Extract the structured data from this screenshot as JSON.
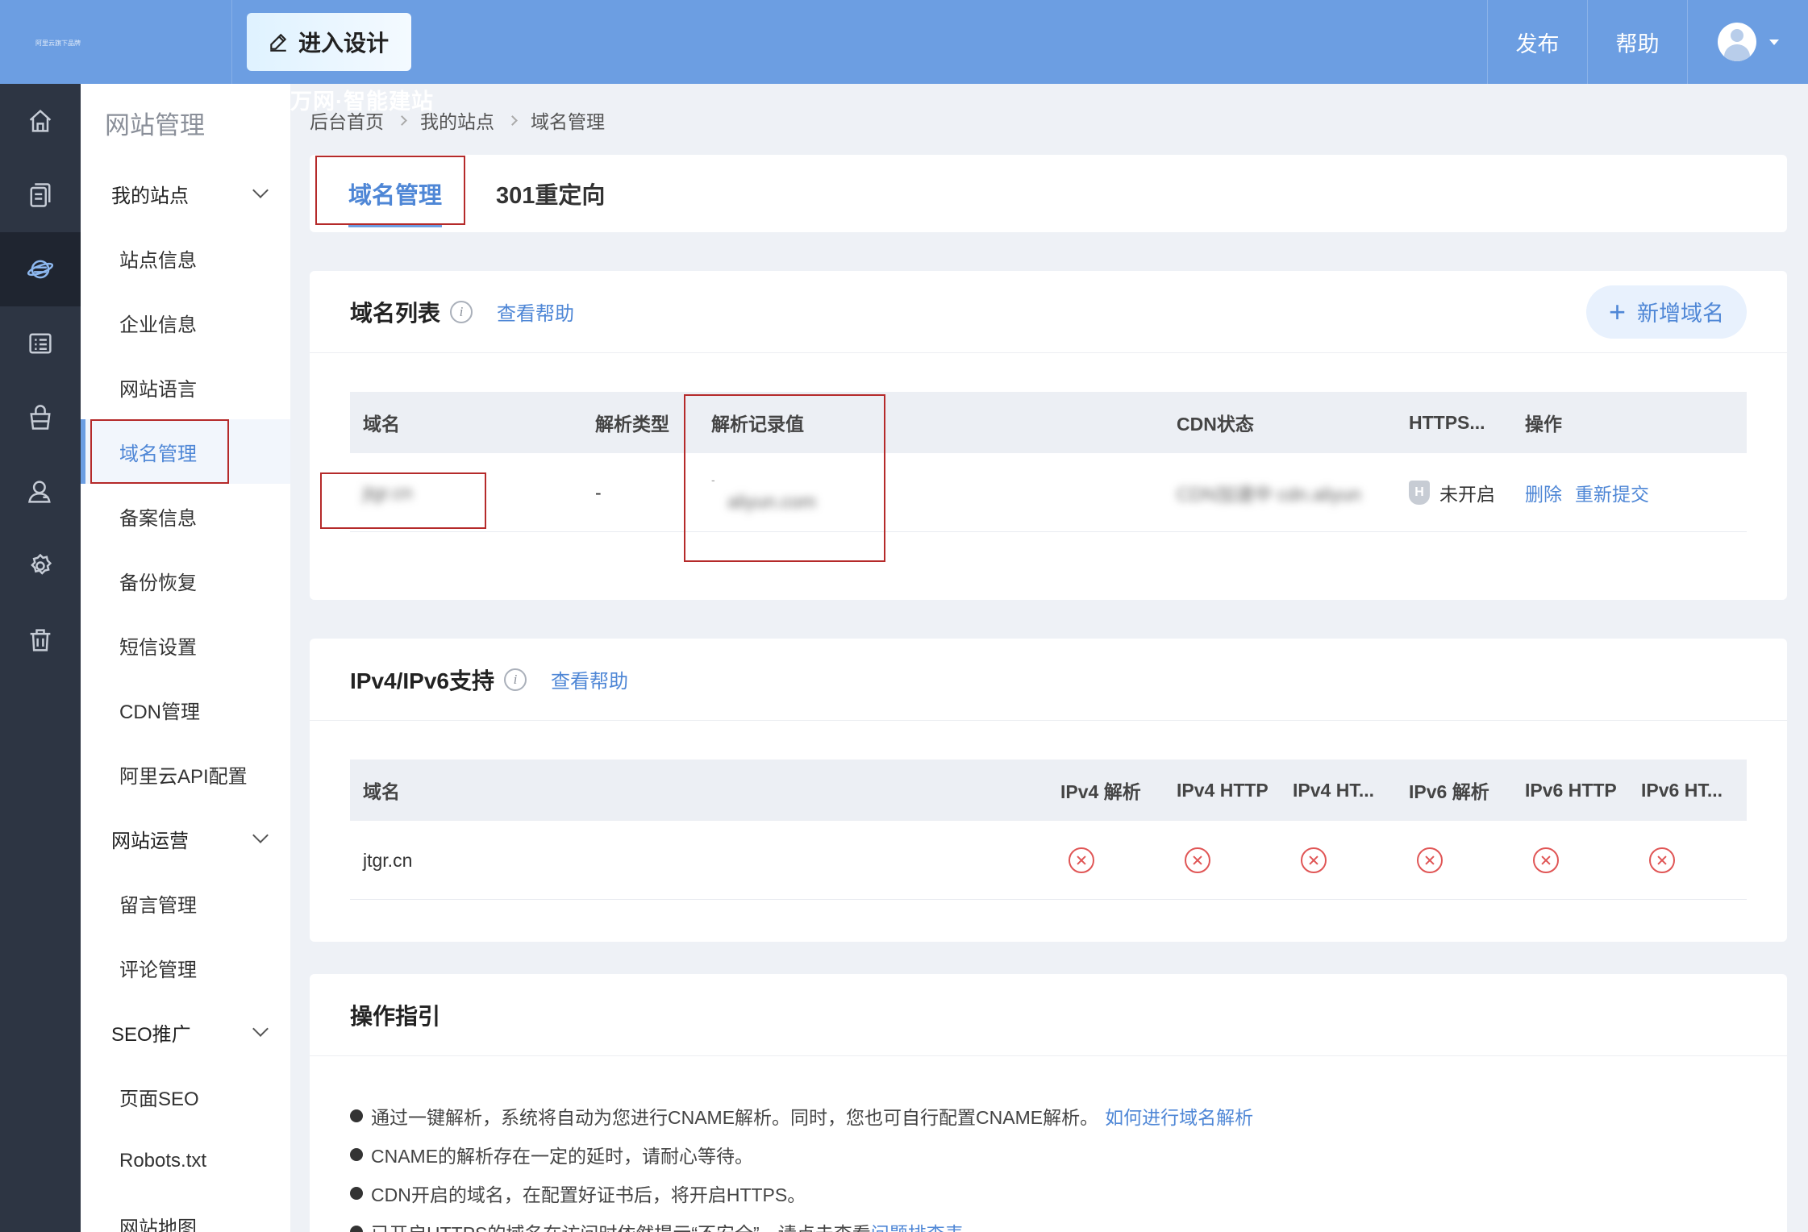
{
  "app": {
    "logo": "万网·智能建站",
    "logo_sub": "阿里云旗下品牌",
    "design_button": "进入设计",
    "publish": "发布",
    "help": "帮助"
  },
  "rail": {
    "items": [
      "home-icon",
      "pages-icon",
      "site-globe-icon",
      "list-icon",
      "store-icon",
      "users-icon",
      "settings-icon",
      "trash-icon"
    ]
  },
  "sidebar": {
    "title": "网站管理",
    "groups": [
      {
        "label": "我的站点",
        "items": [
          "站点信息",
          "企业信息",
          "网站语言",
          "域名管理",
          "备案信息",
          "备份恢复",
          "短信设置",
          "CDN管理",
          "阿里云API配置"
        ]
      },
      {
        "label": "网站运营",
        "items": [
          "留言管理",
          "评论管理"
        ]
      },
      {
        "label": "SEO推广",
        "items": [
          "页面SEO",
          "Robots.txt",
          "网站地图"
        ]
      }
    ]
  },
  "breadcrumb": [
    "后台首页",
    "我的站点",
    "域名管理"
  ],
  "tabs": [
    "域名管理",
    "301重定向"
  ],
  "domain_list": {
    "title": "域名列表",
    "help": "查看帮助",
    "add_button": "新增域名",
    "columns": [
      "域名",
      "解析类型",
      "解析记录值",
      "CDN状态",
      "HTTPS...",
      "操作"
    ],
    "row": {
      "domain": "jtgr.cn",
      "type": "-",
      "record_dash": "-",
      "record": "aliyun.com",
      "cdn": "CDN加速中 cdn.aliyun",
      "https_badge": "H",
      "https": "未开启",
      "action_delete": "删除",
      "action_resubmit": "重新提交"
    }
  },
  "ipv": {
    "title": "IPv4/IPv6支持",
    "help": "查看帮助",
    "columns": [
      "域名",
      "IPv4 解析",
      "IPv4 HTTP",
      "IPv4 HT...",
      "IPv6 解析",
      "IPv6 HTTP",
      "IPv6 HT..."
    ],
    "row_domain": "jtgr.cn"
  },
  "guide": {
    "title": "操作指引",
    "items": [
      {
        "text": "通过一键解析，系统将自动为您进行CNAME解析。同时，您也可自行配置CNAME解析。",
        "link": "如何进行域名解析"
      },
      {
        "text": "CNAME的解析存在一定的延时，请耐心等待。",
        "link": ""
      },
      {
        "text": "CDN开启的域名，在配置好证书后，将开启HTTPS。",
        "link": ""
      },
      {
        "text": "已开启HTTPS的域名在访问时依然提示“不安全”，请点击查看",
        "link": "问题排查表"
      }
    ]
  }
}
